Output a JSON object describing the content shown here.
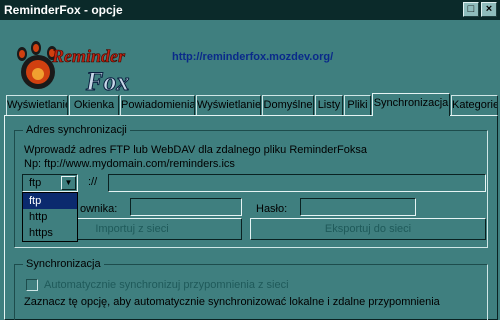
{
  "window": {
    "title": "ReminderFox - opcje",
    "close_label": "×",
    "max_label": "□"
  },
  "header": {
    "url": "http://reminderfox.mozdev.org/",
    "logo_text_top": "Reminder",
    "logo_text_bottom": "Fox"
  },
  "tabs": [
    {
      "label": "Wyświetlanie"
    },
    {
      "label": "Okienka"
    },
    {
      "label": "Powiadomienia"
    },
    {
      "label": "Wyświetlanie"
    },
    {
      "label": "Domyślne"
    },
    {
      "label": "Listy"
    },
    {
      "label": "Pliki"
    },
    {
      "label": "Synchronizacja"
    },
    {
      "label": "Kategorie"
    }
  ],
  "sync_address": {
    "group_label": "Adres synchronizacji",
    "description": "Wprowadź adres FTP lub WebDAV dla zdalnego pliku ReminderFoksa",
    "example": "Np: ftp://www.mydomain.com/reminders.ics",
    "protocol_selected": "ftp",
    "protocol_options": [
      "ftp",
      "http",
      "https"
    ],
    "separator": "://",
    "url_value": "",
    "user_label": "ownika:",
    "user_value": "",
    "password_label": "Hasło:",
    "password_value": "",
    "import_button": "Importuj z sieci",
    "export_button": "Eksportuj do sieci"
  },
  "sync": {
    "group_label": "Synchronizacja",
    "auto_sync_label": "Automatycznie synchronizuj przypomnienia z sieci",
    "auto_sync_checked": false,
    "hint": "Zaznacz tę opcję, aby automatycznie synchronizować lokalne i zdalne przypomnienia"
  }
}
